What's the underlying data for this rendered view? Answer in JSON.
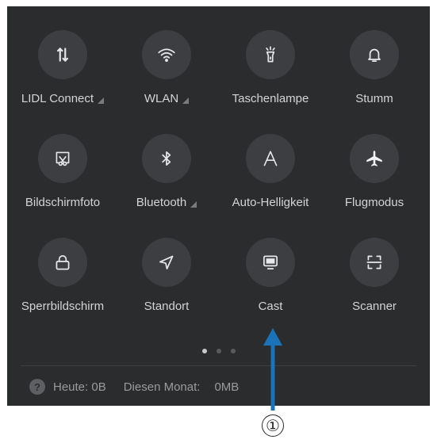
{
  "tiles": [
    {
      "label": "LIDL Connect",
      "icon": "data-transfer-icon"
    },
    {
      "label": "WLAN",
      "icon": "wifi-icon"
    },
    {
      "label": "Taschenlampe",
      "icon": "flashlight-icon"
    },
    {
      "label": "Stumm",
      "icon": "bell-icon"
    },
    {
      "label": "Bildschirmfoto",
      "icon": "screenshot-icon"
    },
    {
      "label": "Bluetooth",
      "icon": "bluetooth-icon"
    },
    {
      "label": "Auto-Helligkeit",
      "icon": "auto-brightness-icon"
    },
    {
      "label": "Flugmodus",
      "icon": "airplane-icon"
    },
    {
      "label": "Sperrbildschirm",
      "icon": "lock-icon"
    },
    {
      "label": "Standort",
      "icon": "location-icon"
    },
    {
      "label": "Cast",
      "icon": "cast-icon"
    },
    {
      "label": "Scanner",
      "icon": "scanner-icon"
    }
  ],
  "footer": {
    "today_label": "Heute: 0B",
    "month_label": "Diesen Monat:",
    "month_value": "0MB"
  },
  "annotation": {
    "marker": "①",
    "color": "#1a73b8"
  },
  "colors": {
    "panel": "#2b2c2e",
    "tile": "#3d3e41",
    "text": "#d3d4d6"
  }
}
